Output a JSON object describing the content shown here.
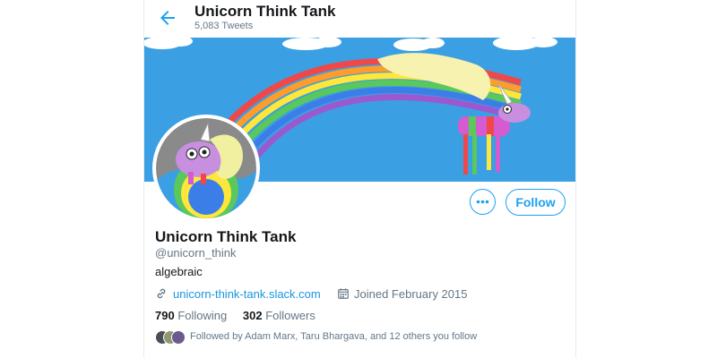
{
  "header": {
    "title": "Unicorn Think Tank",
    "tweet_count": "5,083 Tweets"
  },
  "profile": {
    "name": "Unicorn Think Tank",
    "handle": "@unicorn_think",
    "bio": "algebraic",
    "link": "unicorn-think-tank.slack.com",
    "joined": "Joined February 2015"
  },
  "actions": {
    "follow_label": "Follow",
    "more_label": "•••"
  },
  "stats": {
    "following_count": "790",
    "following_label": "Following",
    "followers_count": "302",
    "followers_label": "Followers"
  },
  "followed_by": {
    "text": "Followed by Adam Marx, Taru Bhargava, and 12 others you follow"
  },
  "colors": {
    "accent": "#1da1f2",
    "banner_sky": "#3aa0e3",
    "muted": "#657786"
  },
  "icons": [
    "back-arrow-icon",
    "link-icon",
    "calendar-icon",
    "more-icon"
  ]
}
